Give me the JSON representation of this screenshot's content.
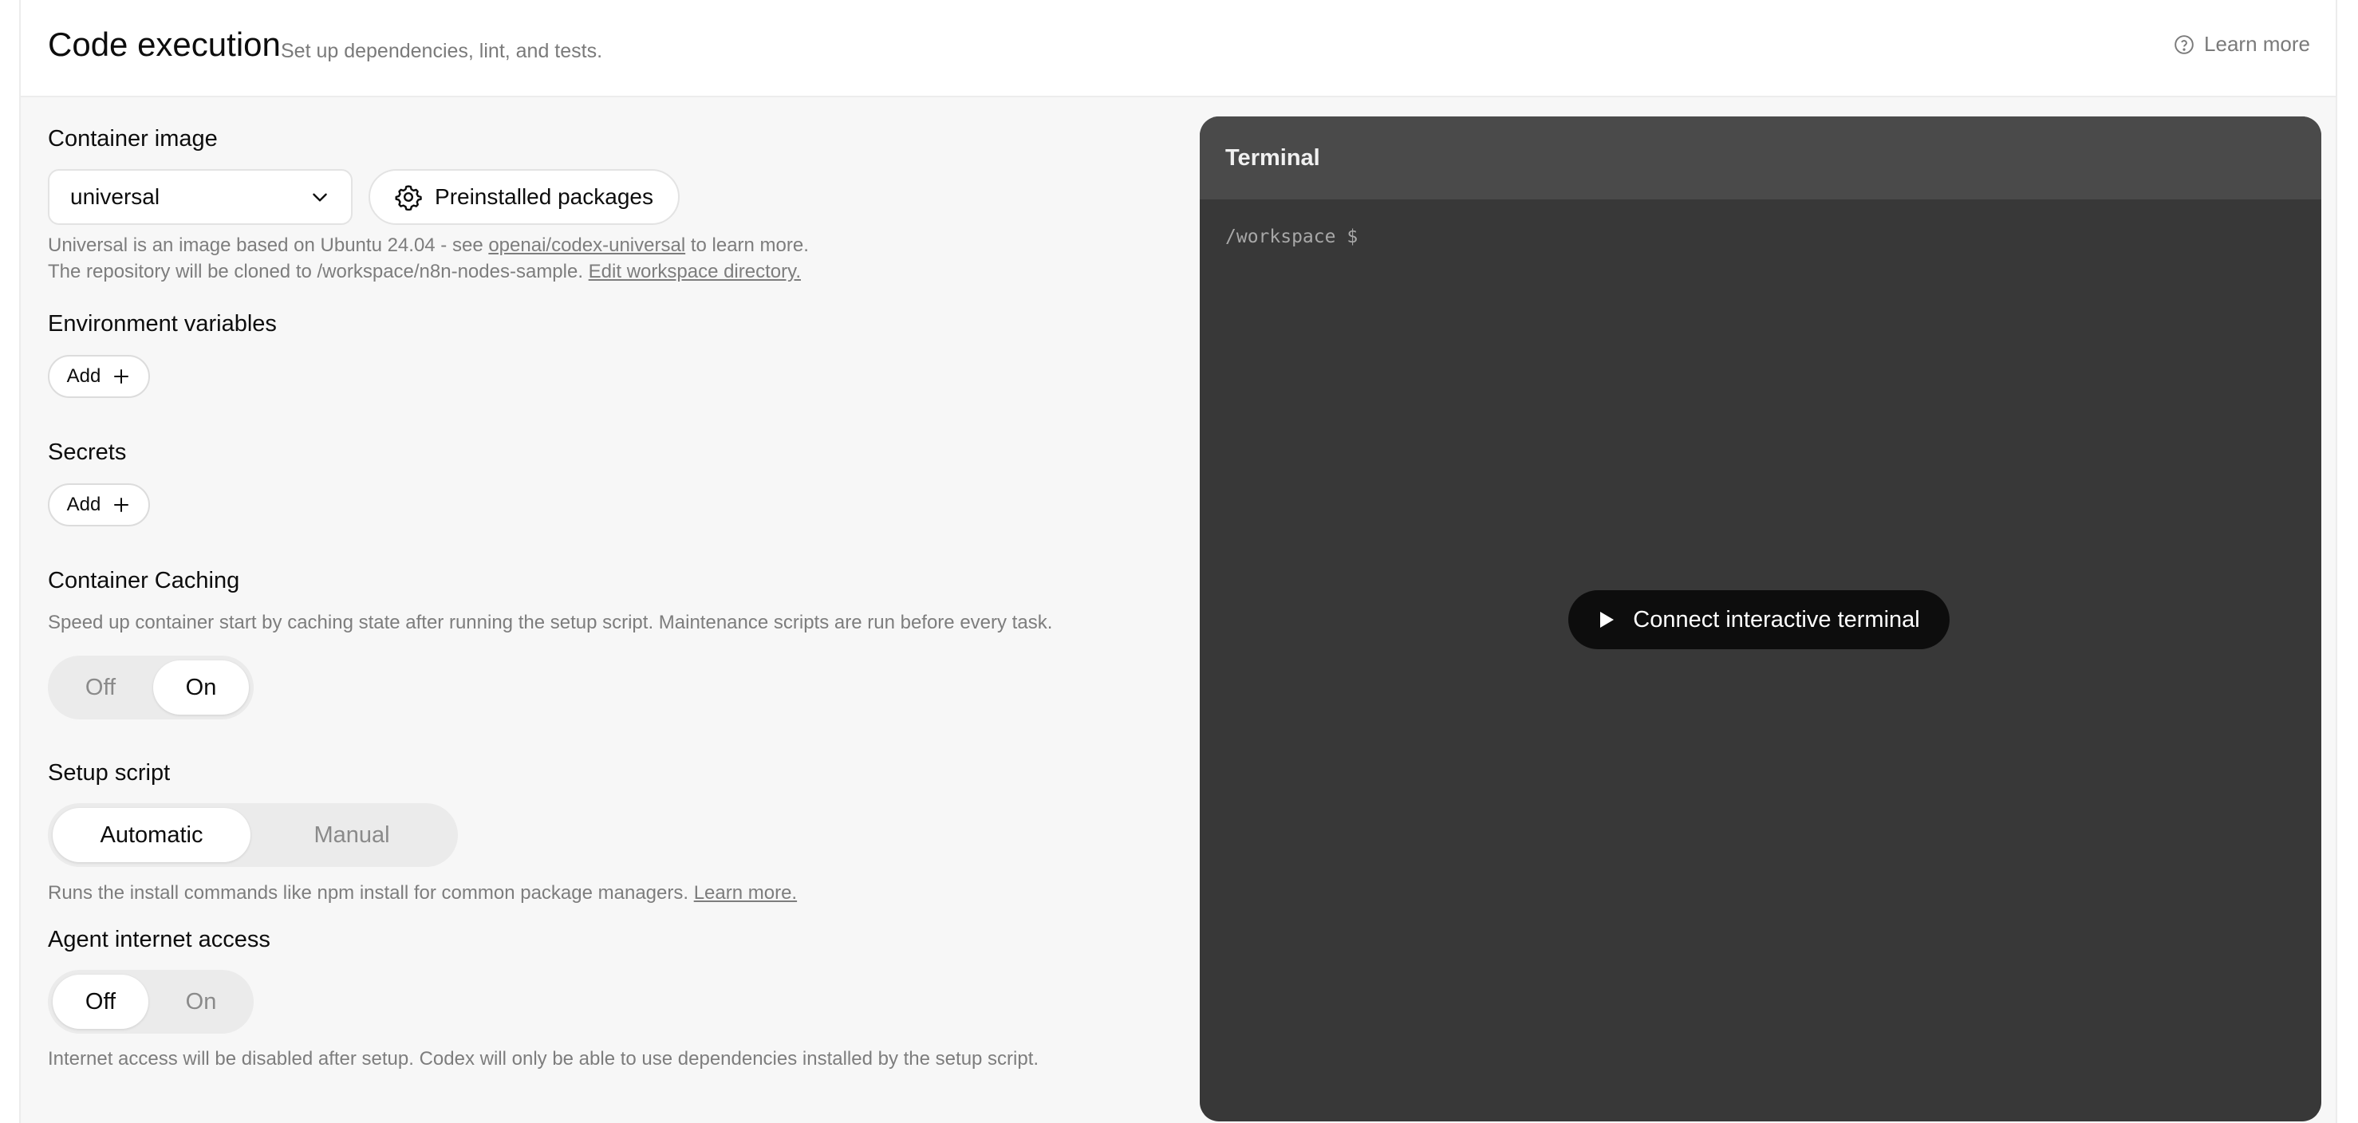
{
  "header": {
    "title": "Code execution",
    "subtitle": "Set up dependencies, lint, and tests.",
    "learn_more": "Learn more"
  },
  "container_image": {
    "label": "Container image",
    "selected": "universal",
    "packages_button": "Preinstalled packages",
    "help_line1_pre": "Universal is an image based on Ubuntu 24.04 - see ",
    "help_line1_link": "openai/codex-universal",
    "help_line1_post": " to learn more.",
    "help_line2_pre": "The repository will be cloned to /workspace/n8n-nodes-sample. ",
    "help_line2_link": "Edit workspace directory."
  },
  "env_vars": {
    "label": "Environment variables",
    "add_label": "Add"
  },
  "secrets": {
    "label": "Secrets",
    "add_label": "Add"
  },
  "caching": {
    "label": "Container Caching",
    "help": "Speed up container start by caching state after running the setup script. Maintenance scripts are run before every task.",
    "options": [
      "Off",
      "On"
    ],
    "selected": "On"
  },
  "setup_script": {
    "label": "Setup script",
    "options": [
      "Automatic",
      "Manual"
    ],
    "selected": "Automatic",
    "help_pre": "Runs the install commands like npm install for common package managers. ",
    "help_link": "Learn more."
  },
  "internet": {
    "label": "Agent internet access",
    "options": [
      "Off",
      "On"
    ],
    "selected": "Off",
    "help": "Internet access will be disabled after setup. Codex will only be able to use dependencies installed by the setup script."
  },
  "terminal": {
    "title": "Terminal",
    "prompt": "/workspace $",
    "connect_label": "Connect interactive terminal"
  }
}
